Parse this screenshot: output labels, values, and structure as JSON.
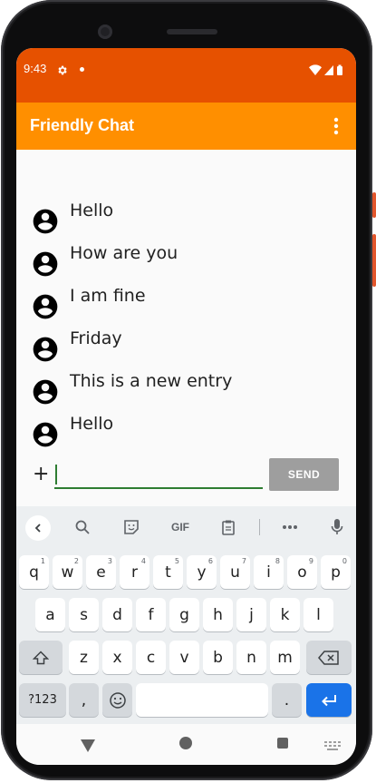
{
  "status_bar": {
    "time": "9:43",
    "icons": [
      "gear-icon",
      "notification-dot-icon",
      "wifi-icon",
      "signal-icon",
      "battery-icon"
    ],
    "color": "#e65100"
  },
  "app_bar": {
    "title": "Friendly Chat",
    "color": "#ff8f00",
    "menu_icon": "more-vert-icon"
  },
  "messages": [
    {
      "text": "Hello"
    },
    {
      "text": "How are you"
    },
    {
      "text": "I am fine"
    },
    {
      "text": "Friday"
    },
    {
      "text": "This is a new entry"
    },
    {
      "text": "Hello"
    }
  ],
  "composer": {
    "add_label": "+",
    "input_value": "",
    "send_label": "SEND",
    "accent": "#2e7d32"
  },
  "keyboard": {
    "toolbar": {
      "gif_label": "GIF",
      "icons": [
        "chevron-left-icon",
        "search-icon",
        "sticker-icon",
        "gif-icon",
        "clipboard-icon",
        "more-horiz-icon",
        "mic-icon"
      ]
    },
    "row1": [
      {
        "k": "q",
        "h": "1"
      },
      {
        "k": "w",
        "h": "2"
      },
      {
        "k": "e",
        "h": "3"
      },
      {
        "k": "r",
        "h": "4"
      },
      {
        "k": "t",
        "h": "5"
      },
      {
        "k": "y",
        "h": "6"
      },
      {
        "k": "u",
        "h": "7"
      },
      {
        "k": "i",
        "h": "8"
      },
      {
        "k": "o",
        "h": "9"
      },
      {
        "k": "p",
        "h": "0"
      }
    ],
    "row2": [
      "a",
      "s",
      "d",
      "f",
      "g",
      "h",
      "j",
      "k",
      "l"
    ],
    "row3": [
      "z",
      "x",
      "c",
      "v",
      "b",
      "n",
      "m"
    ],
    "symbols_label": "?123",
    "comma_label": ",",
    "period_label": ".",
    "enter_color": "#1a73e8"
  }
}
